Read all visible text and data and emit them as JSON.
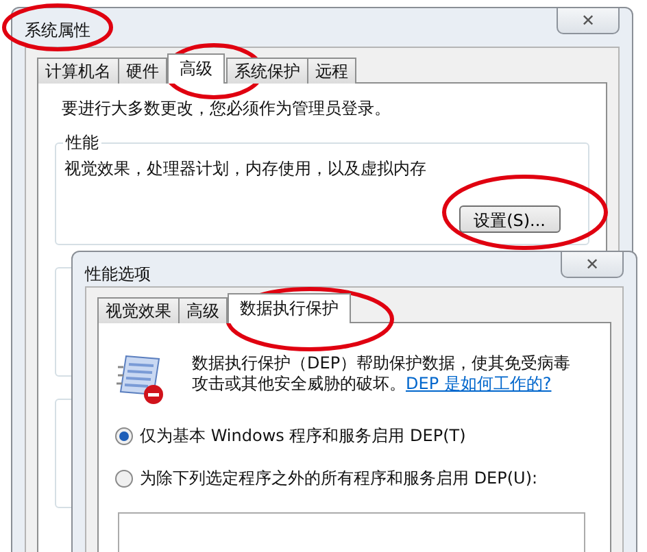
{
  "window": {
    "title": "系统属性",
    "close": "✕",
    "tabs": [
      {
        "label": "计算机名",
        "selected": false
      },
      {
        "label": "硬件",
        "selected": false
      },
      {
        "label": "高级",
        "selected": true
      },
      {
        "label": "系统保护",
        "selected": false
      },
      {
        "label": "远程",
        "selected": false
      }
    ],
    "notice": "要进行大多数更改，您必须作为管理员登录。",
    "performance": {
      "label": "性能",
      "description": "视觉效果，处理器计划，内存使用，以及虚拟内存",
      "button": "设置(S)..."
    }
  },
  "dialog": {
    "title": "性能选项",
    "close": "✕",
    "tabs": [
      {
        "label": "视觉效果",
        "selected": false
      },
      {
        "label": "高级",
        "selected": false
      },
      {
        "label": "数据执行保护",
        "selected": true
      }
    ],
    "description": "数据执行保护（DEP）帮助保护数据，使其免受病毒攻击或其他安全威胁的破坏。",
    "link": "DEP 是如何工作的?",
    "options": [
      {
        "label": "仅为基本 Windows 程序和服务启用 DEP(T)",
        "selected": true
      },
      {
        "label": "为除下列选定程序之外的所有程序和服务启用 DEP(U):",
        "selected": false
      }
    ]
  }
}
